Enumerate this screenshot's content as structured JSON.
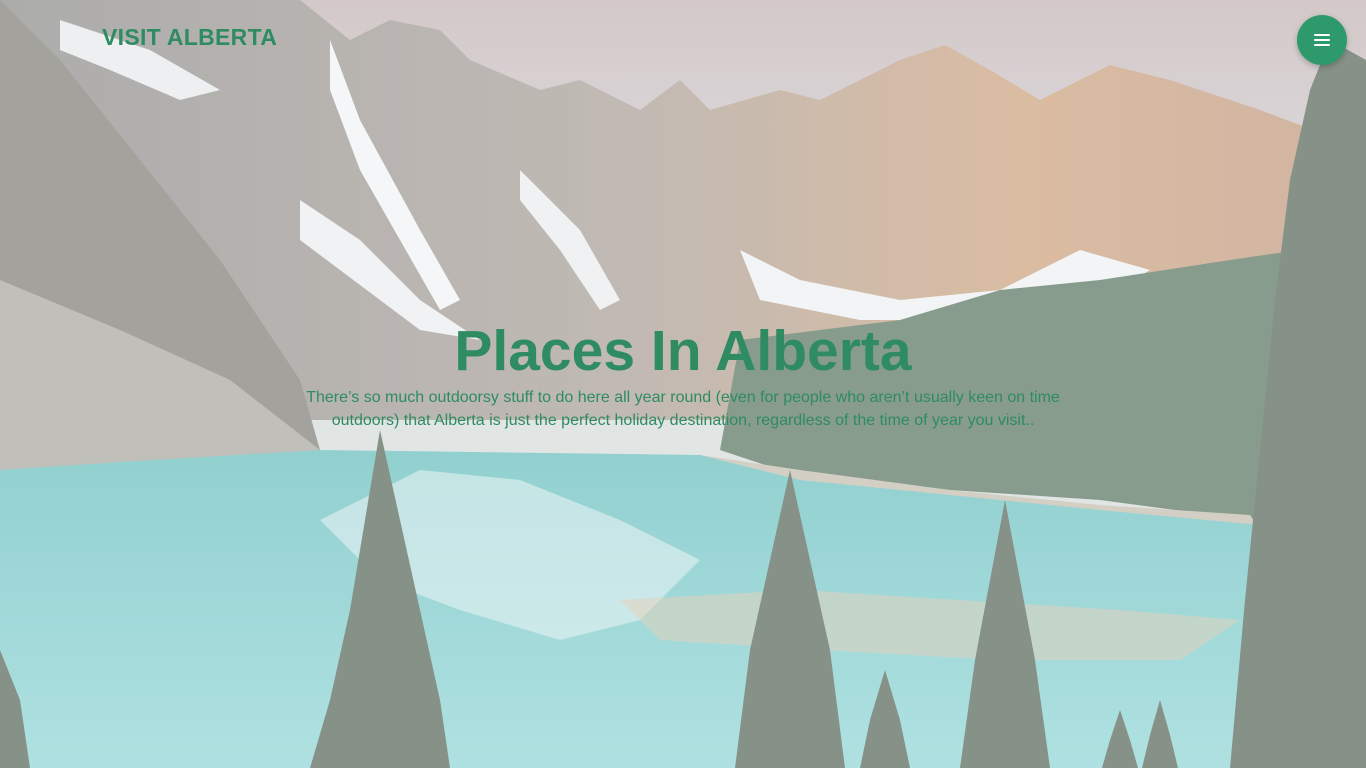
{
  "header": {
    "brand": "VISIT ALBERTA",
    "menu_icon": "hamburger-menu-icon"
  },
  "hero": {
    "title": "Places In Alberta",
    "description": "There’s so much outdoorsy stuff to do here all year round (even for people who aren’t usually keen on time outdoors) that Alberta is just the perfect holiday destination, regardless of the time of year you visit..",
    "background": "mountain-lake-landscape"
  },
  "colors": {
    "accent": "#2e8b62",
    "menu_button": "#2e9a6b",
    "lake": "#6fc4c4",
    "forest": "#3f6048"
  }
}
